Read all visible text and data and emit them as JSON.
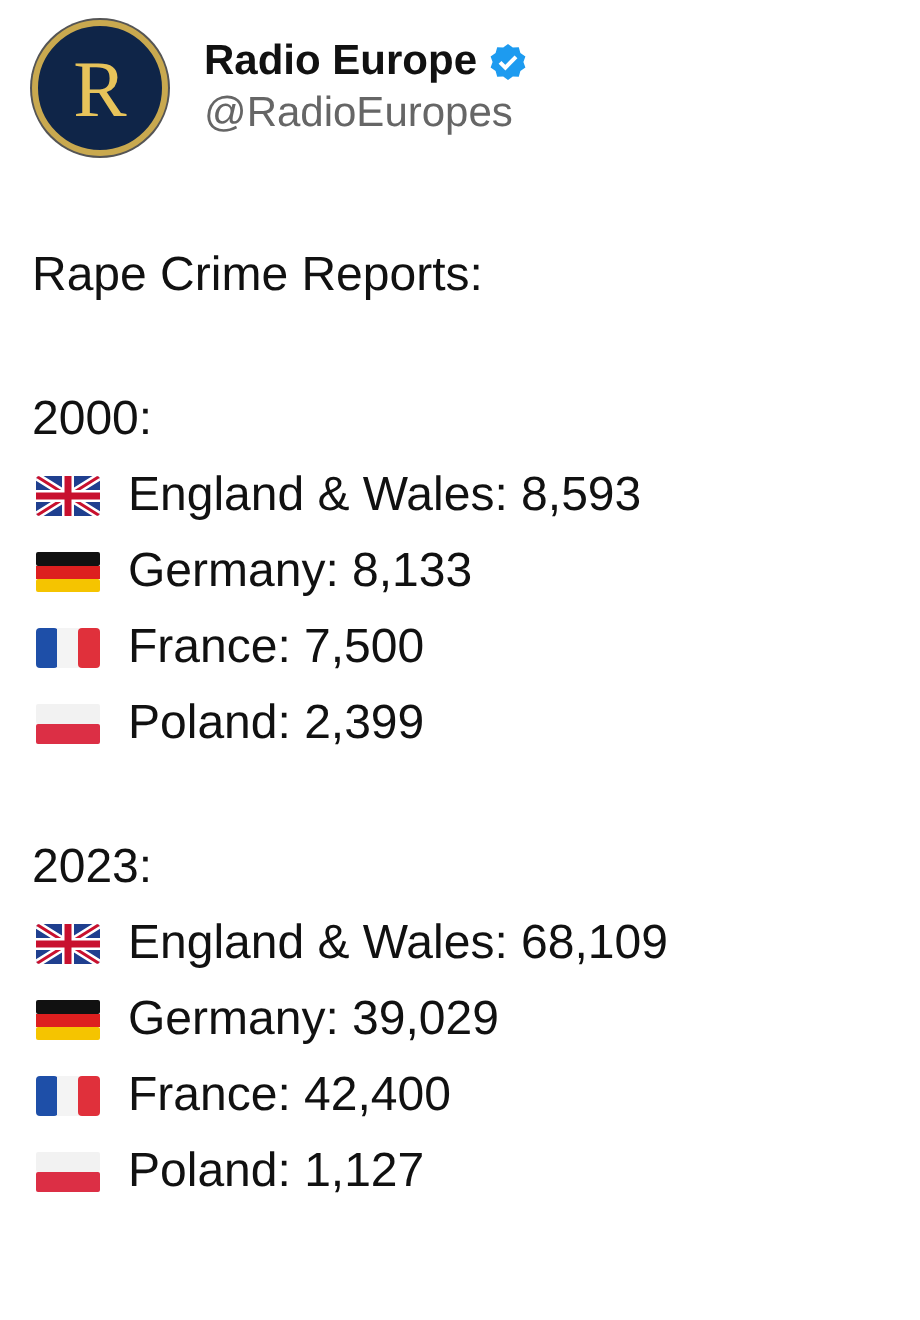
{
  "account": {
    "avatar_letter": "R",
    "name": "Radio Europe",
    "verified": true,
    "handle": "@RadioEuropes"
  },
  "heading": "Rape Crime Reports:",
  "sections": [
    {
      "year": "2000:",
      "rows": [
        {
          "kind": "gb",
          "text": "England & Wales: 8,593"
        },
        {
          "kind": "de",
          "text": "Germany: 8,133"
        },
        {
          "kind": "fr",
          "text": "France: 7,500"
        },
        {
          "kind": "pl",
          "text": "Poland: 2,399"
        }
      ]
    },
    {
      "year": "2023:",
      "rows": [
        {
          "kind": "gb",
          "text": "England & Wales: 68,109"
        },
        {
          "kind": "de",
          "text": "Germany: 39,029"
        },
        {
          "kind": "fr",
          "text": "France: 42,400"
        },
        {
          "kind": "pl",
          "text": "Poland: 1,127"
        }
      ]
    }
  ]
}
